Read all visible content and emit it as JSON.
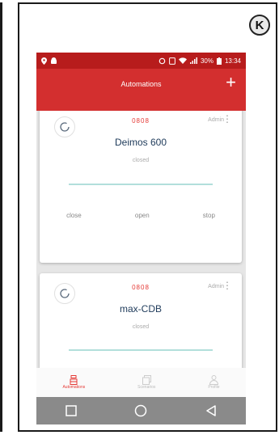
{
  "corner_label": "K",
  "status_bar": {
    "time": "13:34",
    "battery": "30%"
  },
  "app_bar": {
    "title": "Automations",
    "add_label": "+"
  },
  "cards": [
    {
      "code": "0808",
      "role": "Admin",
      "name": "Deimos 600",
      "state": "closed",
      "actions": [
        "close",
        "open",
        "stop"
      ]
    },
    {
      "code": "0808",
      "role": "Admin",
      "name": "max-CDB",
      "state": "closed"
    }
  ],
  "bottom_nav": [
    {
      "label": "Automations",
      "icon": "automation-icon",
      "active": true
    },
    {
      "label": "Scenarios",
      "icon": "scenarios-icon",
      "active": false
    },
    {
      "label": "Profile",
      "icon": "profile-icon",
      "active": false
    }
  ],
  "system_nav": [
    "square-icon",
    "circle-icon",
    "back-triangle-icon"
  ],
  "colors": {
    "primary": "#d32f2f",
    "status_bar": "#b71c1c",
    "accent": "#e53935",
    "progress": "#b2dfdb"
  }
}
